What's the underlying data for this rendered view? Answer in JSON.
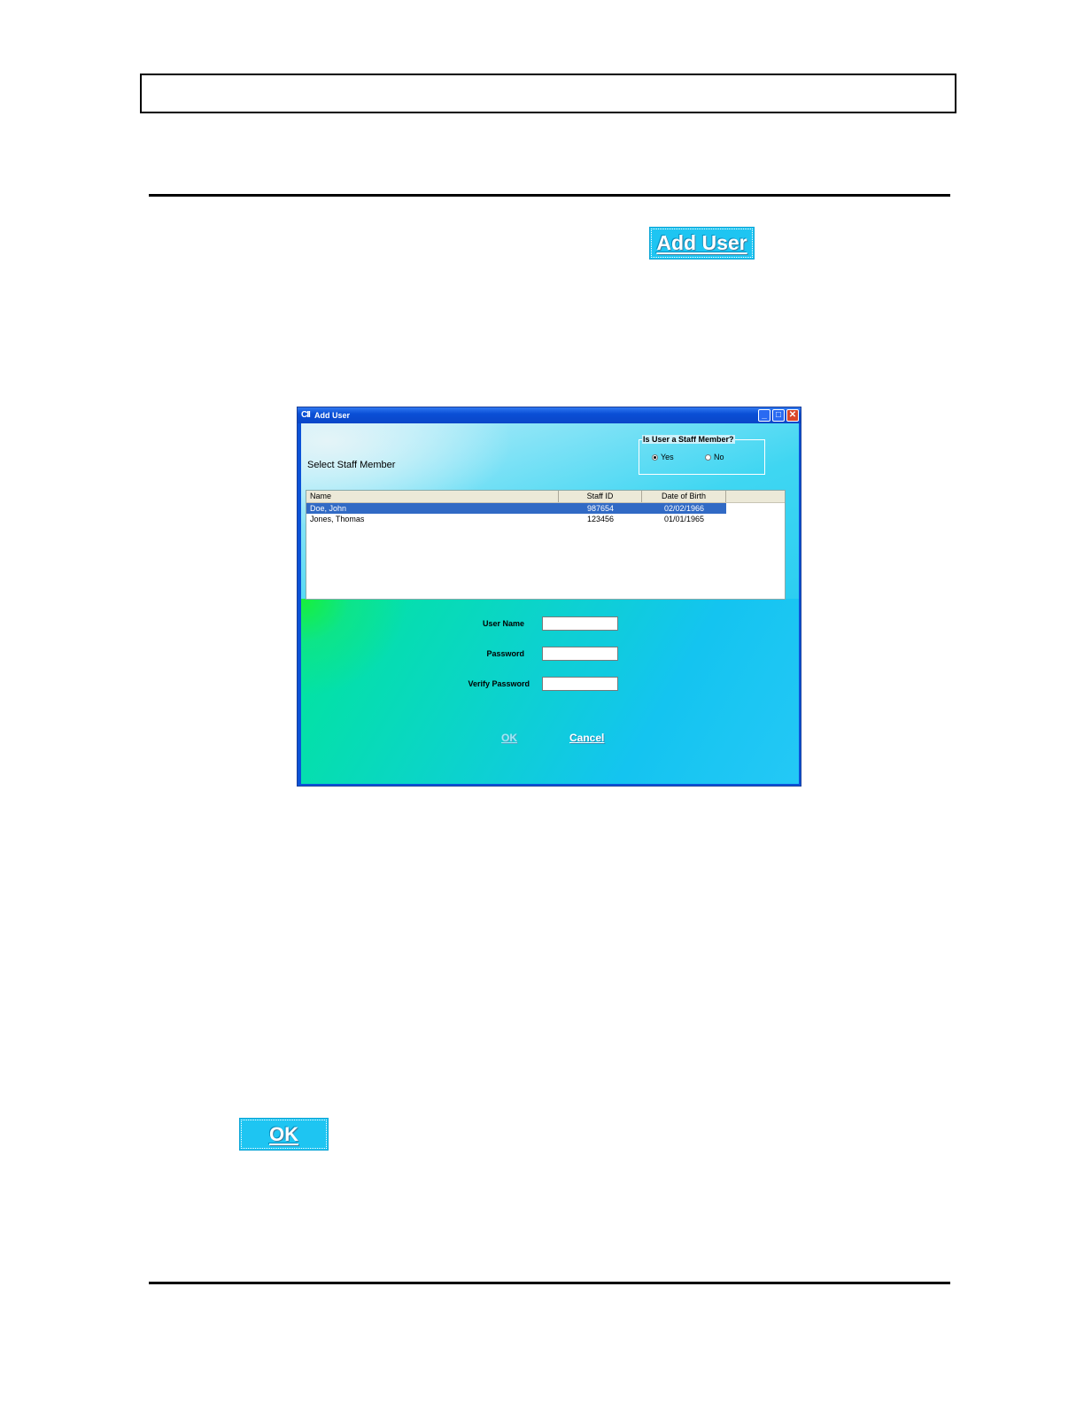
{
  "page": {
    "add_user_button": "Add User",
    "ok_button": "OK"
  },
  "dialog": {
    "title": "Add User",
    "app_icon": "CII",
    "select_label": "Select Staff Member",
    "staff_group": {
      "title": "Is User a Staff Member?",
      "options": [
        "Yes",
        "No"
      ],
      "selected": "Yes"
    },
    "table": {
      "columns": [
        "Name",
        "Staff ID",
        "Date of Birth"
      ],
      "rows": [
        {
          "name": "Doe, John",
          "staff_id": "987654",
          "dob": "02/02/1966",
          "selected": true
        },
        {
          "name": "Jones, Thomas",
          "staff_id": "123456",
          "dob": "01/01/1965",
          "selected": false
        }
      ]
    },
    "fields": {
      "user_name_label": "User Name",
      "password_label": "Password",
      "verify_password_label": "Verify Password",
      "user_name_value": "",
      "password_value": "",
      "verify_password_value": ""
    },
    "buttons": {
      "ok": "OK",
      "cancel": "Cancel"
    },
    "window_controls": {
      "minimize": "_",
      "maximize": "□",
      "close": "✕"
    }
  }
}
